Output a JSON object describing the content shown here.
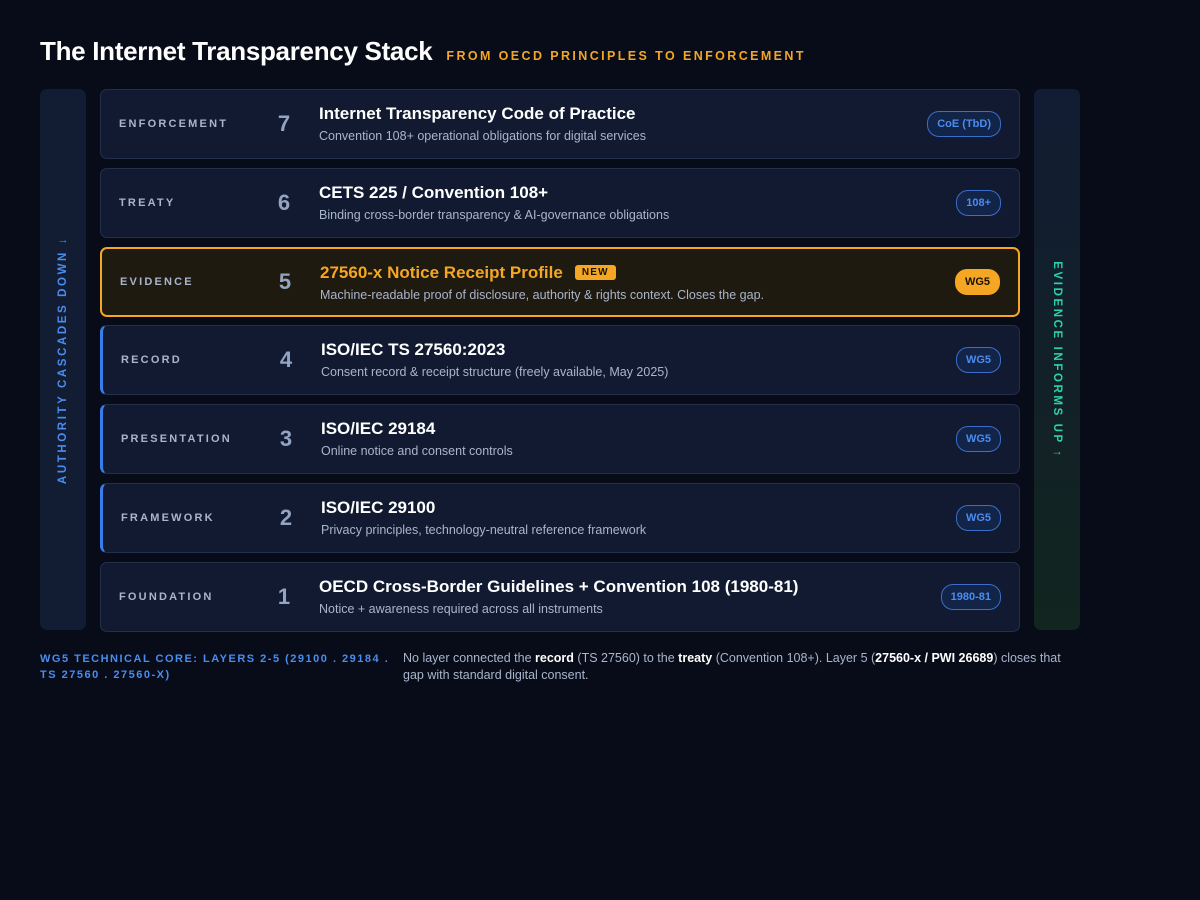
{
  "header": {
    "title": "The Internet Transparency Stack",
    "subtitle": "From OECD Principles to Enforcement"
  },
  "rails": {
    "left": "Authority cascades down ↓",
    "right": "Evidence informs up ↑"
  },
  "layers": [
    {
      "label": "Enforcement",
      "number": "7",
      "title": "Internet Transparency Code of Practice",
      "description": "Convention 108+ operational obligations for digital services",
      "tag": "CoE (TbD)",
      "badge": ""
    },
    {
      "label": "Treaty",
      "number": "6",
      "title": "CETS 225 / Convention 108+",
      "description": "Binding cross-border transparency & AI-governance obligations",
      "tag": "108+",
      "badge": ""
    },
    {
      "label": "Evidence",
      "number": "5",
      "title": "27560-x Notice Receipt Profile",
      "description": "Machine-readable proof of disclosure, authority & rights context. Closes the gap.",
      "tag": "WG5",
      "badge": "NEW"
    },
    {
      "label": "Record",
      "number": "4",
      "title": "ISO/IEC TS 27560:2023",
      "description": "Consent record & receipt structure (freely available, May 2025)",
      "tag": "WG5",
      "badge": ""
    },
    {
      "label": "Presentation",
      "number": "3",
      "title": "ISO/IEC 29184",
      "description": "Online notice and consent controls",
      "tag": "WG5",
      "badge": ""
    },
    {
      "label": "Framework",
      "number": "2",
      "title": "ISO/IEC 29100",
      "description": "Privacy principles, technology-neutral reference framework",
      "tag": "WG5",
      "badge": ""
    },
    {
      "label": "Foundation",
      "number": "1",
      "title": "OECD Cross-Border Guidelines + Convention 108 (1980-81)",
      "description": "Notice + awareness required across all instruments",
      "tag": "1980-81",
      "badge": ""
    }
  ],
  "footer": {
    "core": "WG5 Technical Core: Layers 2-5 (29100 . 29184 . TS 27560 . 27560-x)",
    "note": {
      "p1": "No layer connected the ",
      "b1": "record",
      "p2": " (TS 27560) to the ",
      "b2": "treaty",
      "p3": " (Convention 108+). Layer 5 (",
      "b3": "27560-x / PWI 26689",
      "p4": ") closes that gap with standard digital consent."
    }
  },
  "colors": {
    "background": "#070c18",
    "accent_blue": "#4a8cf0",
    "accent_orange": "#f5a623",
    "accent_green": "#2dd4a8"
  }
}
